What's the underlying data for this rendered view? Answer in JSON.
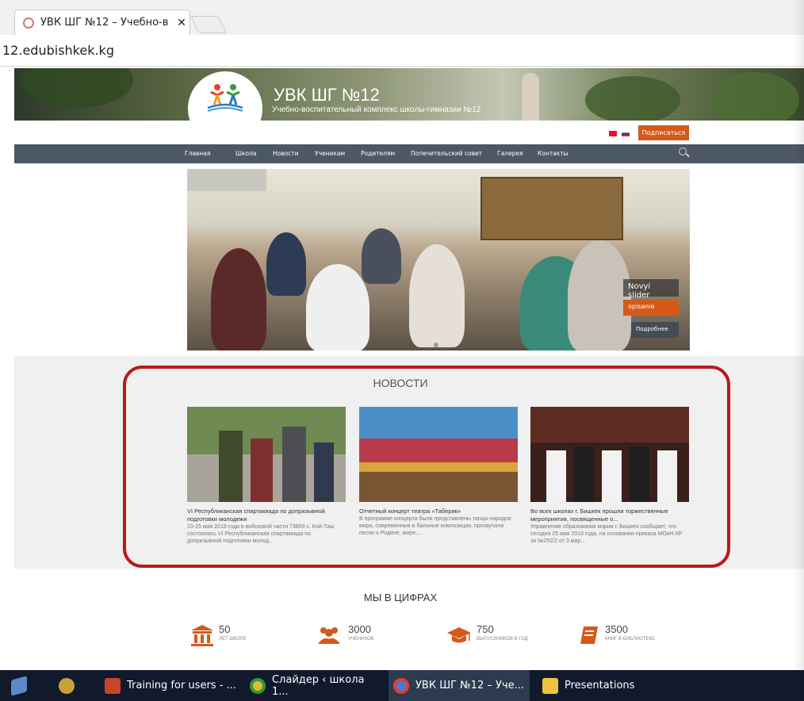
{
  "browser": {
    "tab_title": "УВК ШГ №12 – Учебно-в",
    "close": "✕",
    "url": "12.edubishkek.kg"
  },
  "site": {
    "title": "УВК ШГ №12",
    "subtitle": "Учебно-воспитательный комплекс школы-гимназии №12",
    "subscribe": "Подписаться"
  },
  "nav": {
    "items": [
      "Главная",
      "Школа",
      "Новости",
      "Ученикам",
      "Родителям",
      "Попечительский совет",
      "Галерея",
      "Контакты"
    ]
  },
  "slider": {
    "title": "Novyi slider",
    "caption": "opisanie",
    "more": "Подробнее"
  },
  "news": {
    "title": "НОВОСТИ",
    "cards": [
      {
        "heading": "VI Республиканская спартакиада по допризывной подготовки молодежи",
        "body": "23-25 мая 2018 года  в войсковой части 73809 с. Кой-Таш состоялась VI Республиканская спартакиада по допризывной подготовки молод..."
      },
      {
        "heading": "Отчетный концерт театра «Таберик»",
        "body": "В программе концерта были представлены танцы народов мира, современные и бальные композиции, прозвучали песни о Родине,  мире,..."
      },
      {
        "heading": "Во всех школах г. Бишкек прошли торжественные мероприятия, посвященные о...",
        "body": "Управление образования мэрии г. Бишкек сообщает,  что  сегодня  25 мая 2018 года,  на основании приказа МОиН КР за №252/2 от 3 мар..."
      }
    ]
  },
  "stats": {
    "title": "МЫ В ЦИФРАХ",
    "items": [
      {
        "value": "50",
        "label": "ЛЕТ ШКОЛЕ",
        "icon": "building-icon"
      },
      {
        "value": "3000",
        "label": "УЧЕНИКОВ",
        "icon": "people-icon"
      },
      {
        "value": "750",
        "label": "ВЫПУСКНИКОВ В ГОД",
        "icon": "graduation-cap-icon"
      },
      {
        "value": "3500",
        "label": "КНИГ В БИБЛИОТЕКЕ",
        "icon": "book-icon"
      }
    ]
  },
  "taskbar": {
    "items": [
      "Training for users - ...",
      "Слайдер ‹ школа 1...",
      "УВК ШГ №12 – Уче...",
      "Presentations"
    ]
  },
  "colors": {
    "accent": "#d45a1a",
    "nav": "#4d5866",
    "highlight": "#b81a1a",
    "taskbar": "#101a2c"
  }
}
